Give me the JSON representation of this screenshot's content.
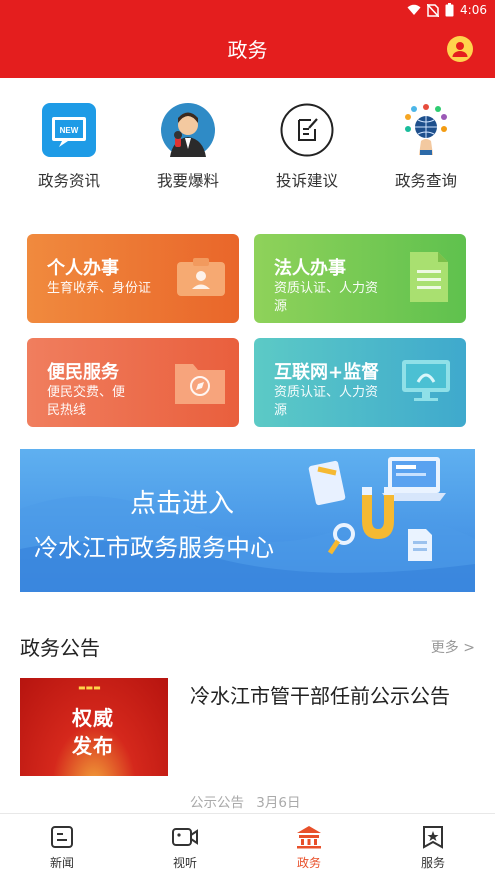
{
  "status_bar": {
    "time": "4:06"
  },
  "header": {
    "title": "政务"
  },
  "quick_links": [
    {
      "label": "政务资讯",
      "icon": "news-icon"
    },
    {
      "label": "我要爆料",
      "icon": "reporter-avatar-icon"
    },
    {
      "label": "投诉建议",
      "icon": "edit-icon"
    },
    {
      "label": "政务查询",
      "icon": "globe-query-icon"
    }
  ],
  "service_cards": [
    {
      "title": "个人办事",
      "subtitle": "生育收养、身份证",
      "color": "#e9662a"
    },
    {
      "title": "法人办事",
      "subtitle": "资质认证、人力资源",
      "color": "#5fc14e"
    },
    {
      "title": "便民服务",
      "subtitle": "便民交费、便民热线",
      "color": "#e95f3d"
    },
    {
      "title": "互联网+监督",
      "subtitle": "资质认证、人力资源",
      "color": "#3fa9cd"
    }
  ],
  "banner": {
    "line1": "点击进入",
    "line2": "冷水江市政务服务中心"
  },
  "announcements": {
    "title": "政务公告",
    "more": "更多 >",
    "item": {
      "thumb_text": "权威\n发布",
      "title": "冷水江市管干部任前公示公告",
      "category": "公示公告",
      "date": "3月6日"
    }
  },
  "tabbar": [
    {
      "label": "新闻",
      "icon": "news-tab-icon"
    },
    {
      "label": "视听",
      "icon": "video-tab-icon"
    },
    {
      "label": "政务",
      "icon": "government-tab-icon",
      "active": true
    },
    {
      "label": "服务",
      "icon": "service-tab-icon"
    }
  ],
  "colors": {
    "brand_red": "#e41e1e",
    "active_tab": "#e8502a"
  }
}
